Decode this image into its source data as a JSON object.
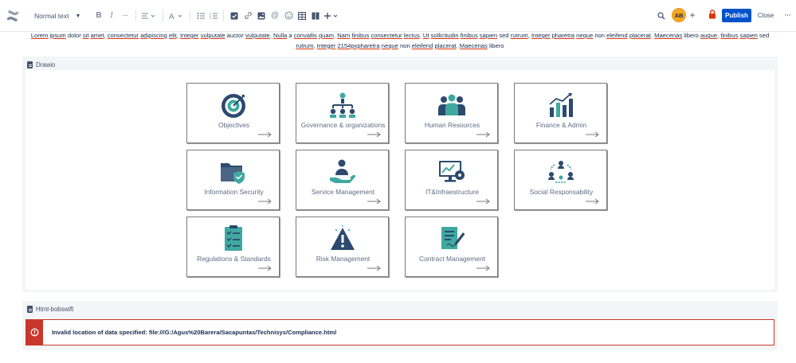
{
  "toolbar": {
    "text_style": "Normal text",
    "avatar_initials": "AB",
    "publish_label": "Publish",
    "close_label": "Close",
    "more_glyph": "···",
    "icons": [
      "bold-icon",
      "italic-icon",
      "more-formatting-icon",
      "align-icon",
      "text-color-icon",
      "bullet-list-icon",
      "numbered-list-icon",
      "task-icon",
      "link-icon",
      "image-icon",
      "mention-icon",
      "emoji-icon",
      "table-icon",
      "layout-icon",
      "insert-plus-icon",
      "search-icon",
      "add-collaborator-icon",
      "restrictions-lock-icon",
      "more-actions-icon"
    ]
  },
  "paragraph": {
    "segments": [
      [
        "Lorem",
        true
      ],
      [
        " ",
        false
      ],
      [
        "ipsum",
        true
      ],
      [
        " dolor ",
        false
      ],
      [
        "sit",
        true
      ],
      [
        " ",
        false
      ],
      [
        "amet",
        true
      ],
      [
        ", ",
        false
      ],
      [
        "consectetur",
        true
      ],
      [
        " ",
        false
      ],
      [
        "adipiscing",
        true
      ],
      [
        " ",
        false
      ],
      [
        "elit",
        true
      ],
      [
        ", ",
        false
      ],
      [
        "Integer",
        true
      ],
      [
        " ",
        false
      ],
      [
        "vulputate",
        true
      ],
      [
        " auctor ",
        false
      ],
      [
        "vulputate",
        true
      ],
      [
        ". ",
        false
      ],
      [
        "Nulla",
        true
      ],
      [
        " a ",
        false
      ],
      [
        "convallis",
        true
      ],
      [
        " ",
        false
      ],
      [
        "quam",
        true
      ],
      [
        ". ",
        false
      ],
      [
        "Nam",
        true
      ],
      [
        " ",
        false
      ],
      [
        "finibus",
        true
      ],
      [
        " ",
        false
      ],
      [
        "consectetur",
        true
      ],
      [
        " ",
        false
      ],
      [
        "lectus",
        true
      ],
      [
        ". ",
        false
      ],
      [
        "Ut",
        true
      ],
      [
        " ",
        false
      ],
      [
        "sollicitudin",
        true
      ],
      [
        " ",
        false
      ],
      [
        "finibus",
        true
      ],
      [
        " ",
        false
      ],
      [
        "sapien",
        true
      ],
      [
        " sed ",
        false
      ],
      [
        "rutrum",
        true
      ],
      [
        ", ",
        false
      ],
      [
        "Integer",
        true
      ],
      [
        " ",
        false
      ],
      [
        "pharetra",
        true
      ],
      [
        " ",
        false
      ],
      [
        "neque",
        true
      ],
      [
        " non ",
        false
      ],
      [
        "eleifend",
        true
      ],
      [
        " ",
        false
      ],
      [
        "placerat",
        true
      ],
      [
        ". ",
        false
      ],
      [
        "Maecenas",
        true
      ],
      [
        " libero ",
        false
      ],
      [
        "augue",
        true
      ],
      [
        ", ",
        false
      ],
      [
        "finibus",
        true
      ],
      [
        " ",
        false
      ],
      [
        "sapien",
        true
      ],
      [
        " sed ",
        false
      ],
      [
        "rutrum",
        true
      ],
      [
        ", ",
        false
      ],
      [
        "Integer",
        true
      ],
      [
        " ",
        false
      ],
      [
        "2154pxpharetra",
        true
      ],
      [
        " ",
        false
      ],
      [
        "neque",
        true
      ],
      [
        " non ",
        false
      ],
      [
        "eleifend",
        true
      ],
      [
        " ",
        false
      ],
      [
        "placerat",
        true
      ],
      [
        ". ",
        false
      ],
      [
        "Maecenas",
        true
      ],
      [
        " libero",
        false
      ]
    ]
  },
  "drawio_macro": {
    "title": "Drawio",
    "tiles": [
      {
        "label": "Objectives",
        "icon": "target-icon"
      },
      {
        "label": "Governance & organizations",
        "icon": "org-chart-icon"
      },
      {
        "label": "Human Resources",
        "icon": "people-icon"
      },
      {
        "label": "Finance & Admin",
        "icon": "growth-chart-icon"
      },
      {
        "label": "Information Security",
        "icon": "secure-folder-icon"
      },
      {
        "label": "Service Management",
        "icon": "service-hand-icon"
      },
      {
        "label": "IT&Infraestructure",
        "icon": "monitor-icon"
      },
      {
        "label": "Social Responsability",
        "icon": "community-icon"
      },
      {
        "label": "Regulations & Standards",
        "icon": "checklist-icon"
      },
      {
        "label": "Risk Management",
        "icon": "warning-icon"
      },
      {
        "label": "Contract Management",
        "icon": "contract-icon"
      }
    ]
  },
  "html_macro": {
    "title": "Html-bobswift",
    "error_message": "Invalid location of data specified: file:///G:/Agus%20Barera/Sacapuntas/Technisys/Compliance.html"
  },
  "colors": {
    "primary": "#0052cc",
    "avatar": "#f5a623",
    "error": "#c9372c",
    "icon_navy": "#2c4a6e",
    "icon_teal": "#3fa9a0"
  }
}
